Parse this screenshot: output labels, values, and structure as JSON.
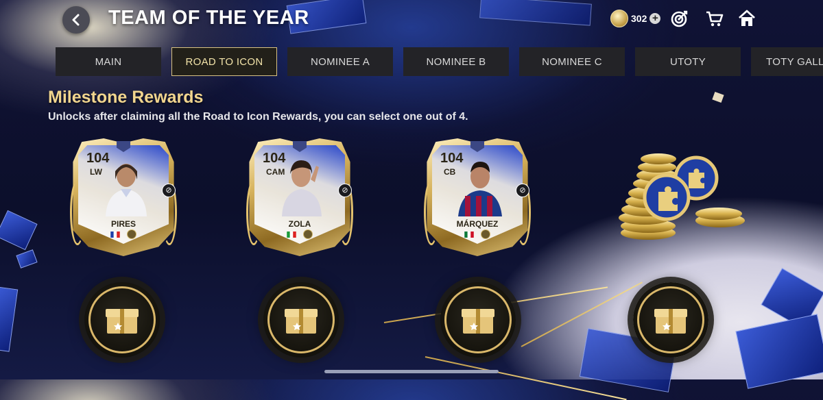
{
  "header": {
    "title": "TEAM OF THE YEAR",
    "coins": "302"
  },
  "tabs": [
    {
      "label": "MAIN",
      "active": false
    },
    {
      "label": "ROAD TO ICON",
      "active": true
    },
    {
      "label": "NOMINEE A",
      "active": false
    },
    {
      "label": "NOMINEE B",
      "active": false
    },
    {
      "label": "NOMINEE C",
      "active": false
    },
    {
      "label": "UTOTY",
      "active": false
    },
    {
      "label": "TOTY GALLE",
      "active": false
    }
  ],
  "milestone": {
    "title": "Milestone Rewards",
    "subtitle": "Unlocks after claiming all the Road to Icon Rewards, you can select one out of 4."
  },
  "cards": [
    {
      "rating": "104",
      "position": "LW",
      "name": "PIRES",
      "nation": "france"
    },
    {
      "rating": "104",
      "position": "CAM",
      "name": "ZOLA",
      "nation": "italy"
    },
    {
      "rating": "104",
      "position": "CB",
      "name": "MÁRQUEZ",
      "nation": "mexico"
    }
  ],
  "icons": {
    "back": "chevron-left-icon",
    "coin": "coin-icon",
    "add": "plus-icon",
    "objectives": "target-icon",
    "store": "cart-icon",
    "home": "home-icon",
    "chest": "reward-chest-icon"
  },
  "colors": {
    "accent_gold": "#f1d58e",
    "tab_bg": "#232327",
    "active_tab_border": "#d9c382"
  }
}
